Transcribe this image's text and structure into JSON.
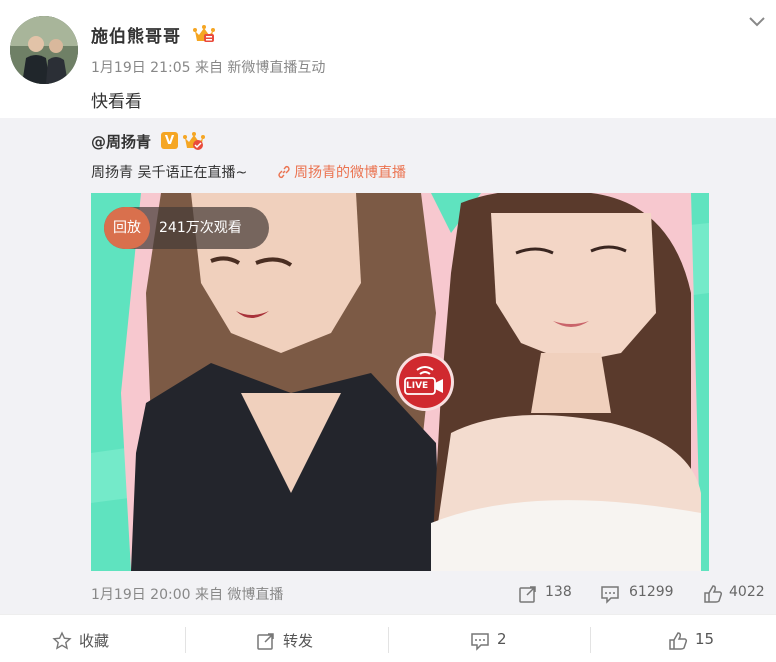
{
  "post": {
    "author": "施伯熊哥哥",
    "meta": "1月19日 21:05 来自 新微博直播互动",
    "text": "快看看",
    "icons": {
      "avatar": "avatar",
      "badge": "crown-badge-icon",
      "more": "chevron-down-icon"
    }
  },
  "repost": {
    "user": "@周扬青",
    "verified_label": "V",
    "text": "周扬青 吴千语正在直播~",
    "link_text": "周扬青的微博直播",
    "live_tag": "回放",
    "views": "241万次观看",
    "live_button": "LIVE",
    "time": "1月19日 20:00 来自 微博直播",
    "stats": {
      "forward": "138",
      "comment": "61299",
      "like": "4022"
    }
  },
  "actions": {
    "favorite": "收藏",
    "forward": "转发",
    "comment": "2",
    "like": "15"
  },
  "colors": {
    "link": "#eb7350",
    "background_media": "#5fe3bf",
    "live_red": "#d0292f"
  }
}
